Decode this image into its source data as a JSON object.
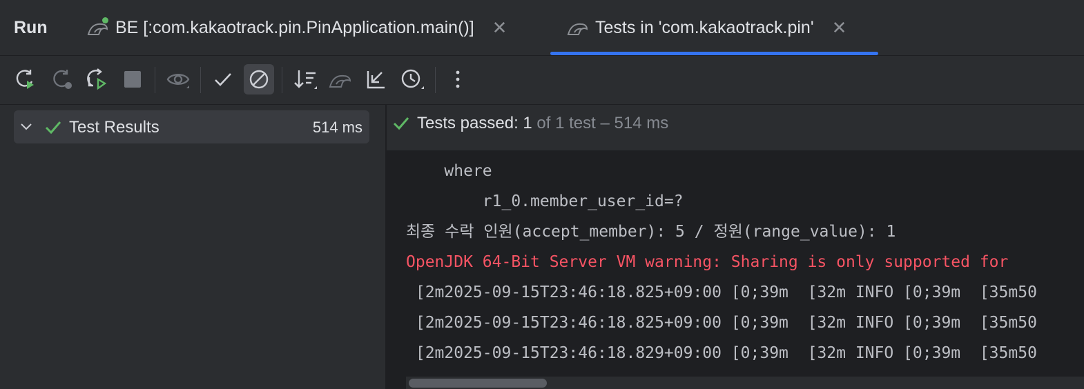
{
  "header": {
    "run_label": "Run",
    "tabs": [
      {
        "label": "BE [:com.kakaotrack.pin.PinApplication.main()]",
        "icon": "spring-run-icon",
        "running": true
      },
      {
        "label": "Tests in 'com.kakaotrack.pin'",
        "icon": "gradle-icon",
        "selected": true
      }
    ]
  },
  "toolbar": {
    "buttons": [
      "rerun-icon",
      "rerun-failed-icon",
      "rerun-auto-icon",
      "stop-icon",
      "show-passed-eye-icon",
      "show-passed-check-icon",
      "show-ignored-icon",
      "sort-icon",
      "gradle-icon",
      "collapse-icon",
      "history-icon",
      "more-icon"
    ]
  },
  "tree": {
    "root_label": "Test Results",
    "root_duration": "514 ms"
  },
  "status": {
    "passed_label": "Tests passed: 1",
    "rest": " of 1 test – 514 ms"
  },
  "console": {
    "lines": [
      "    where",
      "        r1_0.member_user_id=?",
      "최종 수락 인원(accept_member): 5 / 정원(range_value): 1",
      "OpenJDK 64-Bit Server VM warning: Sharing is only supported for",
      " [2m2025-09-15T23:46:18.825+09:00 [0;39m  [32m INFO [0;39m  [35m50",
      " [2m2025-09-15T23:46:18.825+09:00 [0;39m  [32m INFO [0;39m  [35m50",
      " [2m2025-09-15T23:46:18.829+09:00 [0;39m  [32m INFO [0;39m  [35m50"
    ]
  },
  "colors": {
    "accent": "#3574f0",
    "success": "#5fb865",
    "error": "#f75464"
  }
}
